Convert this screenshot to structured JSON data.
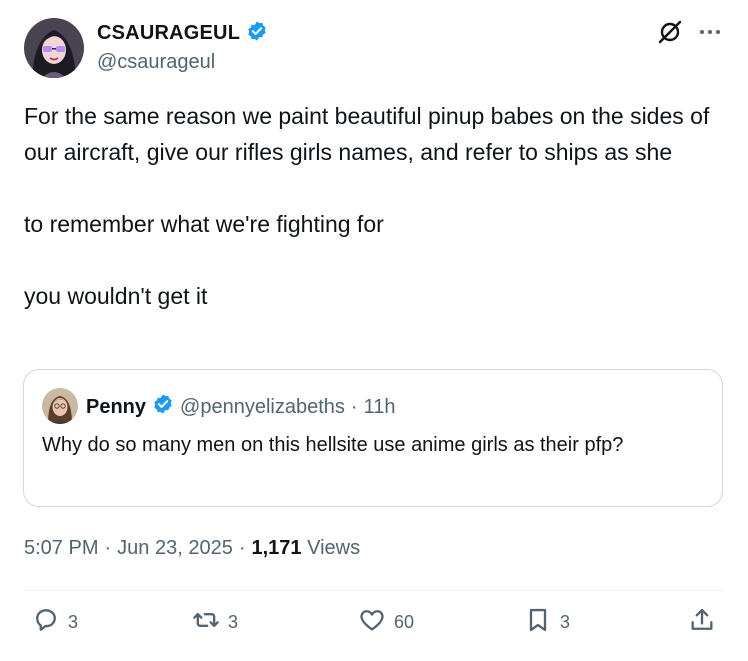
{
  "author": {
    "display_name": "CSAURAGEUL",
    "handle": "@csaurageul"
  },
  "tweet": {
    "text": "For the same reason we paint beautiful pinup babes on the sides of our aircraft, give our rifles girls names, and refer to ships as she\n\nto remember what we're fighting for\n\nyou wouldn't get it"
  },
  "quote": {
    "display_name": "Penny",
    "handle": "@pennyelizabeths",
    "separator": "·",
    "age": "11h",
    "text": "Why do so many men on this hellsite use anime girls as their pfp?"
  },
  "meta": {
    "time": "5:07 PM",
    "dot1": "·",
    "date": "Jun 23, 2025",
    "dot2": "·",
    "views_count": "1,171",
    "views_label": "Views"
  },
  "actions": {
    "replies": "3",
    "reposts": "3",
    "likes": "60",
    "bookmarks": "3"
  },
  "colors": {
    "verified": "#1d9bf0",
    "text": "#0f1419",
    "secondary": "#536471",
    "border": "#cfd9de"
  },
  "icons": [
    "verified-badge-icon",
    "grok-icon",
    "more-icon",
    "reply-icon",
    "repost-icon",
    "like-icon",
    "bookmark-icon",
    "share-icon"
  ]
}
